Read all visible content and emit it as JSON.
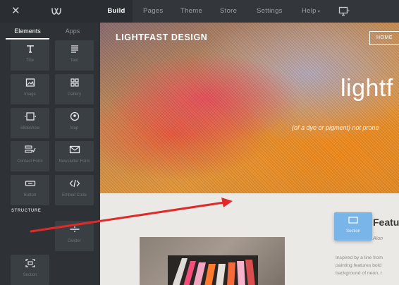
{
  "topbar": {
    "close_glyph": "✕",
    "logo_icon": "weebly-logo-icon",
    "nav": [
      {
        "label": "Build",
        "active": true
      },
      {
        "label": "Pages",
        "active": false
      },
      {
        "label": "Theme",
        "active": false
      },
      {
        "label": "Store",
        "active": false
      },
      {
        "label": "Settings",
        "active": false
      },
      {
        "label": "Help",
        "active": false
      }
    ],
    "help_caret": "▾",
    "device_icon": "desktop-monitor-icon"
  },
  "sidebar": {
    "tabs": [
      {
        "label": "Elements",
        "active": true
      },
      {
        "label": "Apps",
        "active": false
      }
    ],
    "elements": [
      {
        "label": "Title",
        "icon": "title-text-icon"
      },
      {
        "label": "Text",
        "icon": "paragraph-icon"
      },
      {
        "label": "Image",
        "icon": "image-icon"
      },
      {
        "label": "Gallery",
        "icon": "gallery-grid-icon"
      },
      {
        "label": "Slideshow",
        "icon": "slideshow-icon"
      },
      {
        "label": "Map",
        "icon": "map-pin-icon"
      },
      {
        "label": "Contact Form",
        "icon": "contact-form-icon"
      },
      {
        "label": "Newsletter Form",
        "icon": "envelope-icon"
      },
      {
        "label": "Button",
        "icon": "button-icon"
      },
      {
        "label": "Embed Code",
        "icon": "code-icon"
      }
    ],
    "structure_heading": "STRUCTURE",
    "structure": [
      {
        "label": "Divider",
        "icon": "divider-icon"
      },
      {
        "label": "Section",
        "icon": "section-icon"
      }
    ]
  },
  "preview": {
    "brand": "LIGHTFAST DESIGN",
    "home_button": "HOME",
    "hero_title": "lightf",
    "hero_subtitle": "(of a dye or pigment) not prone",
    "feature_title": "Featu",
    "feature_tagline": "In a nutshell, the Alon",
    "feature_body": [
      "Inspired by a line from",
      "painting features bold",
      "background of neon, r"
    ]
  },
  "drag": {
    "label": "Section",
    "icon": "section-icon",
    "arrow_color": "#e02a2a"
  },
  "colors": {
    "accent_blue": "#7ab5ea",
    "panel_dark": "#2e3236",
    "tile": "#3a3f44"
  }
}
